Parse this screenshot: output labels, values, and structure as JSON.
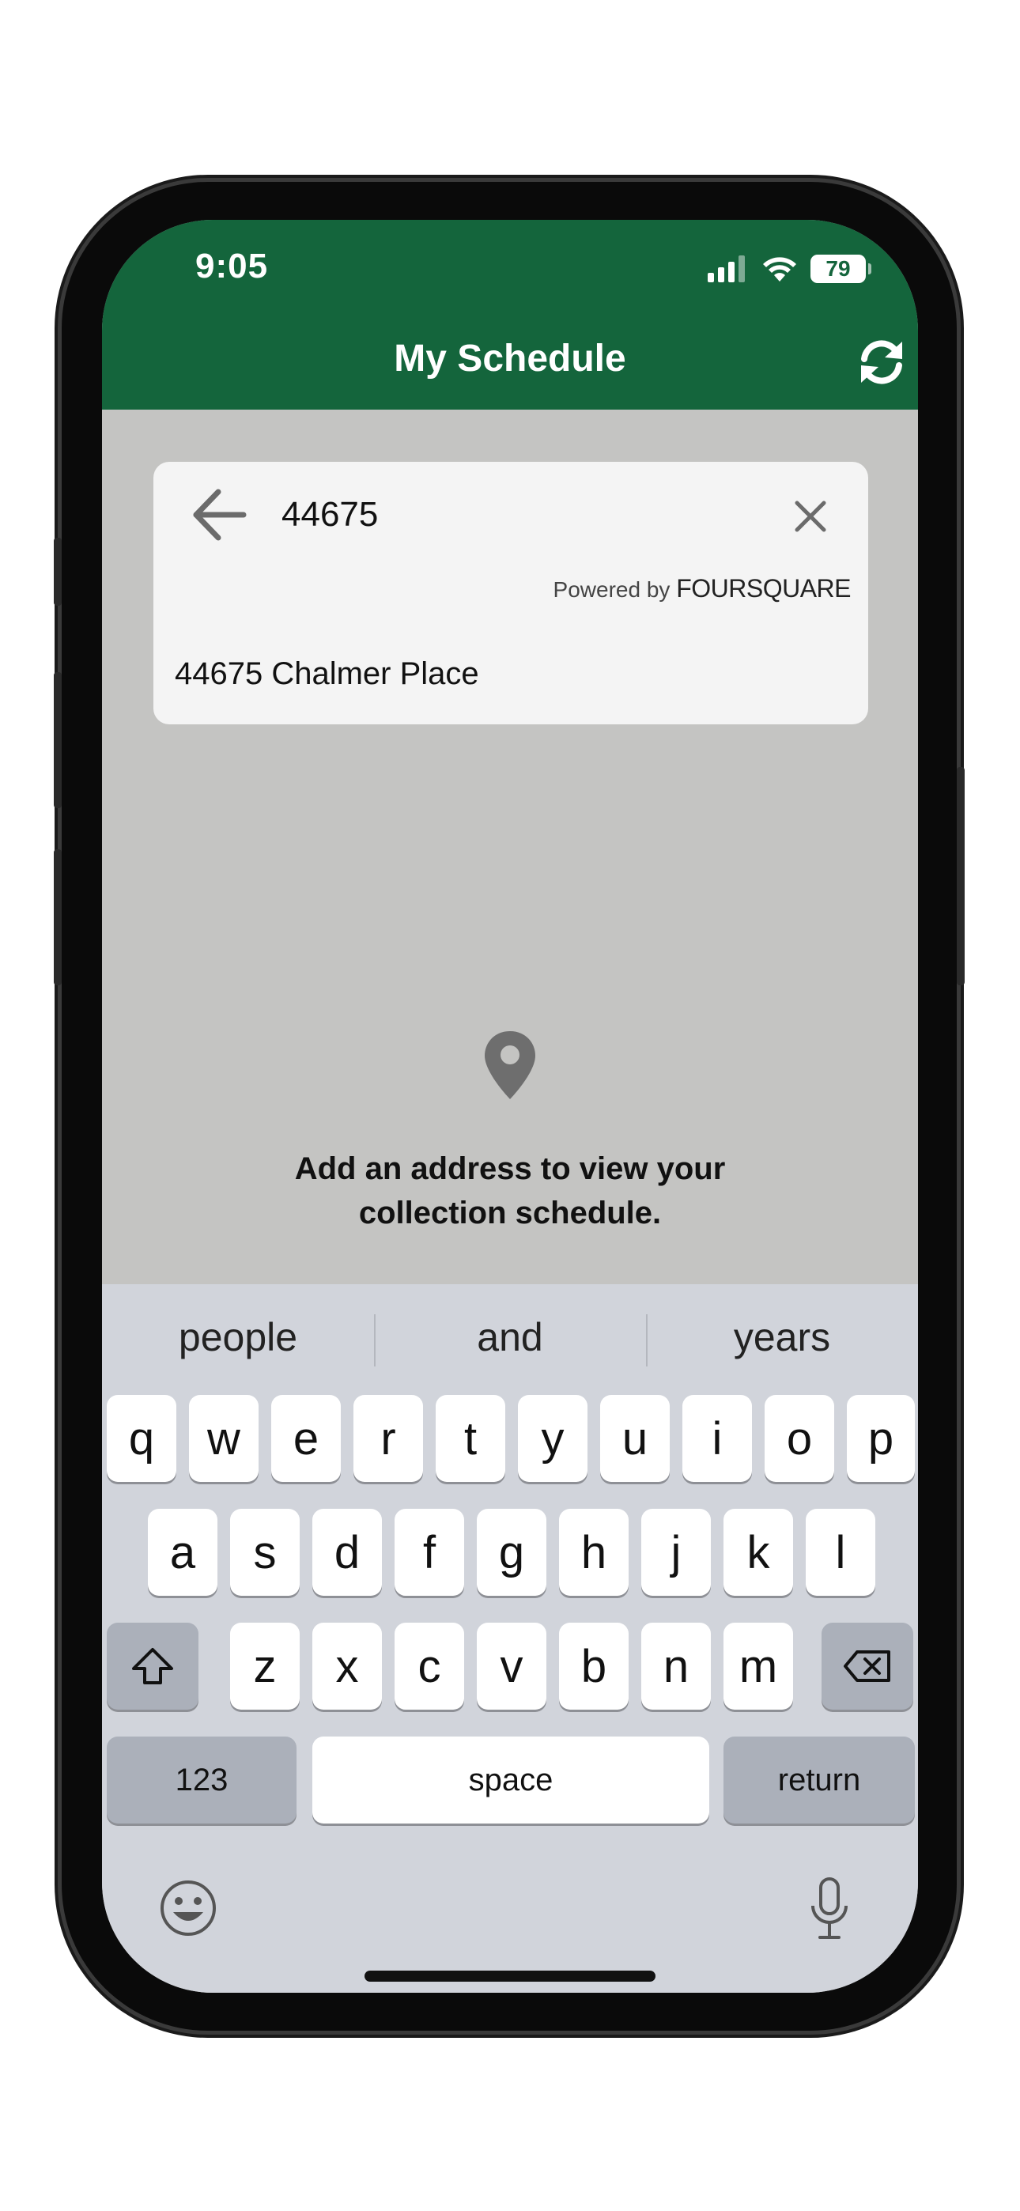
{
  "status_bar": {
    "time": "9:05",
    "battery": "79"
  },
  "header": {
    "title": "My Schedule",
    "refresh_icon": "refresh-icon"
  },
  "search": {
    "value": "44675",
    "powered_prefix": "Powered by",
    "powered_brand": "FOURSQUARE",
    "suggestions": [
      "44675 Chalmer Place"
    ]
  },
  "empty_state": {
    "line1": "Add an address to view your",
    "line2": "collection schedule."
  },
  "keyboard": {
    "predictions": [
      "people",
      "and",
      "years"
    ],
    "row1": [
      "q",
      "w",
      "e",
      "r",
      "t",
      "y",
      "u",
      "i",
      "o",
      "p"
    ],
    "row2": [
      "a",
      "s",
      "d",
      "f",
      "g",
      "h",
      "j",
      "k",
      "l"
    ],
    "row3": [
      "z",
      "x",
      "c",
      "v",
      "b",
      "n",
      "m"
    ],
    "numbers_label": "123",
    "space_label": "space",
    "return_label": "return"
  },
  "colors": {
    "header": "#14653c",
    "background": "#c4c4c2",
    "keyboard": "#d1d4db"
  }
}
